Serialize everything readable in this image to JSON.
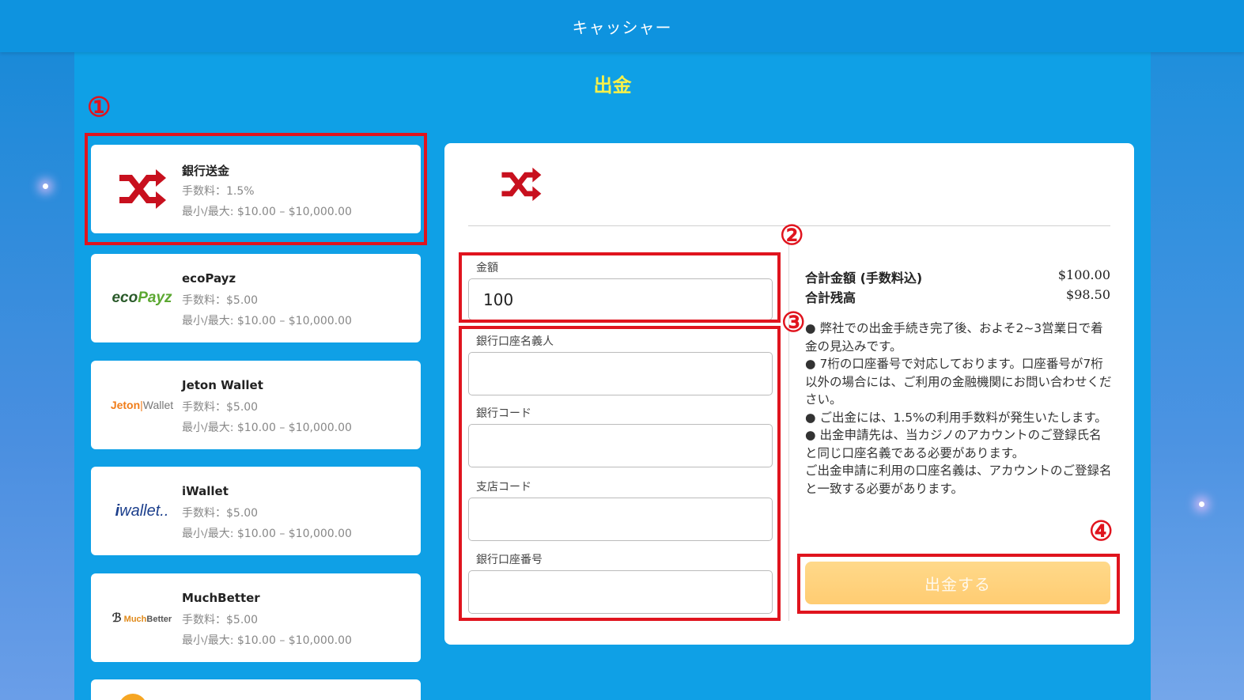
{
  "header": {
    "title": "キャッシャー"
  },
  "page": {
    "title": "出金"
  },
  "methods": [
    {
      "name": "銀行送金",
      "fee": "手数料：1.5%",
      "range": "最小/最大: $10.00 – $10,000.00",
      "logo": "shuffle-icon"
    },
    {
      "name": "ecoPayz",
      "fee": "手数料：$5.00",
      "range": "最小/最大: $10.00 – $10,000.00",
      "logo_text": "ecoPayz"
    },
    {
      "name": "Jeton Wallet",
      "fee": "手数料：$5.00",
      "range": "最小/最大: $10.00 – $10,000.00",
      "logo_text_a": "Jeton",
      "logo_text_b": "Wallet"
    },
    {
      "name": "iWallet",
      "fee": "手数料：$5.00",
      "range": "最小/最大: $10.00 – $10,000.00",
      "logo_text": "wallet.."
    },
    {
      "name": "MuchBetter",
      "fee": "手数料：$5.00",
      "range": "最小/最大: $10.00 – $10,000.00",
      "logo_text": "MuchBetter"
    }
  ],
  "form": {
    "amount_label": "金額",
    "amount_value": "100",
    "account_name_label": "銀行口座名義人",
    "bank_code_label": "銀行コード",
    "branch_code_label": "支店コード",
    "account_number_label": "銀行口座番号"
  },
  "summary": {
    "total_label": "合計金額 (手数料込)",
    "total_value": "$100.00",
    "balance_label": "合計残高",
    "balance_value": "$98.50"
  },
  "notes": [
    "● 弊社での出金手続き完了後、およそ2~3営業日で着金の見込みです。",
    "● 7桁の口座番号で対応しております。口座番号が7桁以外の場合には、ご利用の金融機関にお問い合わせください。",
    "● ご出金には、1.5%の利用手数料が発生いたします。",
    "● 出金申請先は、当カジノのアカウントのご登録氏名と同じ口座名義である必要があります。",
    "ご出金申請に利用の口座名義は、アカウントのご登録名と一致する必要があります。"
  ],
  "submit_label": "出金する",
  "annotations": [
    "①",
    "②",
    "③",
    "④"
  ],
  "colors": {
    "accent_red": "#e0141e",
    "title_yellow": "#f5f04a",
    "button": "#ffcc72"
  }
}
